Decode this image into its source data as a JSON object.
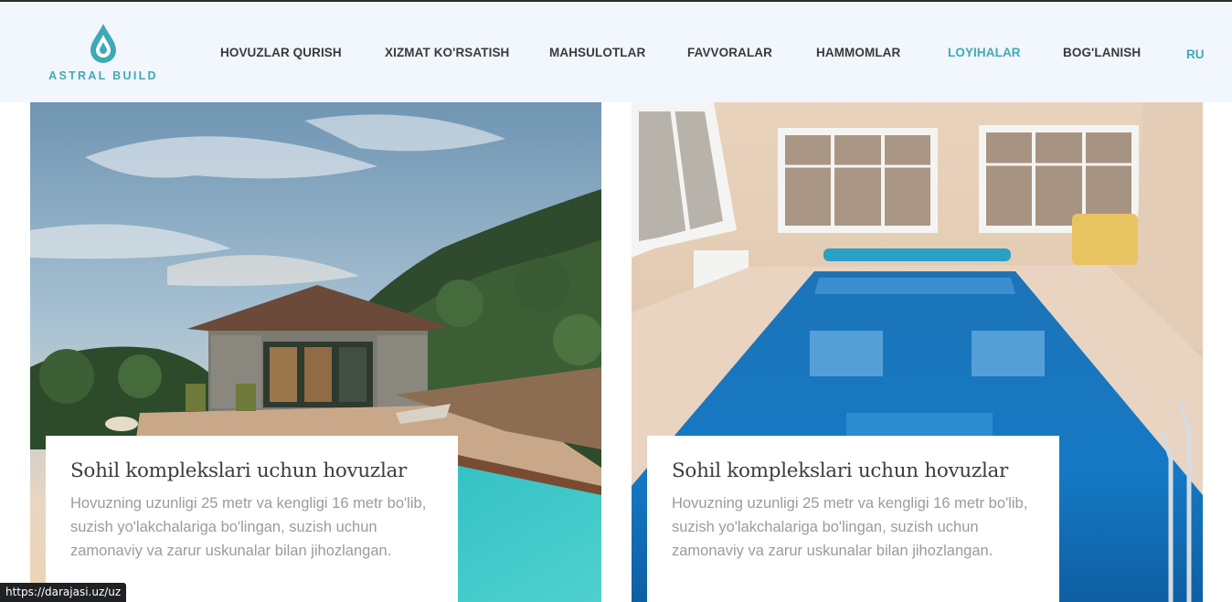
{
  "brand": {
    "name": "ASTRAL BUILD",
    "accent": "#3fa9b5"
  },
  "nav": {
    "items": [
      {
        "label": "HOVUZLAR QURISH",
        "active": false
      },
      {
        "label": "XIZMAT KO'RSATISH",
        "active": false
      },
      {
        "label": "MAHSULOTLAR",
        "active": false
      },
      {
        "label": "FAVVORALAR",
        "active": false
      },
      {
        "label": "HAMMOMLAR",
        "active": false
      },
      {
        "label": "LOYIHALAR",
        "active": true
      },
      {
        "label": "BOG'LANISH",
        "active": false
      }
    ],
    "language": "RU"
  },
  "projects": [
    {
      "title": "Sohil komplekslari uchun hovuzlar",
      "description": "Hovuzning uzunligi 25 metr va kengligi 16 metr bo'lib, suzish yo'lakchalariga bo'lingan, suzish uchun zamonaviy va zarur uskunalar bilan jihozlangan.",
      "image": "outdoor-pool-house-photo"
    },
    {
      "title": "Sohil komplekslari uchun hovuzlar",
      "description": "Hovuzning uzunligi 25 metr va kengligi 16 metr bo'lib, suzish yo'lakchalariga bo'lingan, suzish uchun zamonaviy va zarur uskunalar bilan jihozlangan.",
      "image": "indoor-pool-photo"
    }
  ],
  "status_bar": {
    "url": "https://darajasi.uz/uz"
  }
}
